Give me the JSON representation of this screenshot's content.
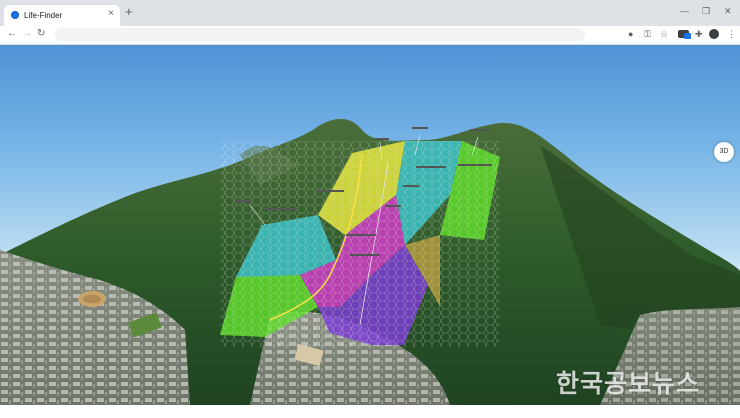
{
  "browser": {
    "tab_title": "Life-Finder",
    "new_tab_symbol": "+",
    "close_symbol": "×",
    "window_controls": {
      "minimize": "—",
      "restore": "❐",
      "close": "✕"
    },
    "nav": {
      "back": "←",
      "forward": "→",
      "reload": "↻"
    },
    "address": "",
    "toolbar_icons": [
      "location-icon",
      "key-icon",
      "star-icon",
      "extension-icon",
      "puzzle-icon",
      "profile-icon",
      "menu-icon"
    ],
    "toolbar_symbols": {
      "location": "●",
      "key": "⚿",
      "star": "☆",
      "puzzle": "✚",
      "menu": "⋮"
    }
  },
  "map": {
    "view_toggle": "3D",
    "watermark": "한국공보뉴스",
    "colors": {
      "sky_top": "#4f93d6",
      "sky_horizon": "#d9ecf6",
      "forest": "#2e5a2a",
      "zone_cyan": "#3cc3c8",
      "zone_green": "#5edb2a",
      "zone_magenta": "#d23cc8",
      "zone_purple": "#7a3cd2",
      "zone_yellow": "#e6e63c",
      "zone_olive": "#b49a3c"
    }
  }
}
